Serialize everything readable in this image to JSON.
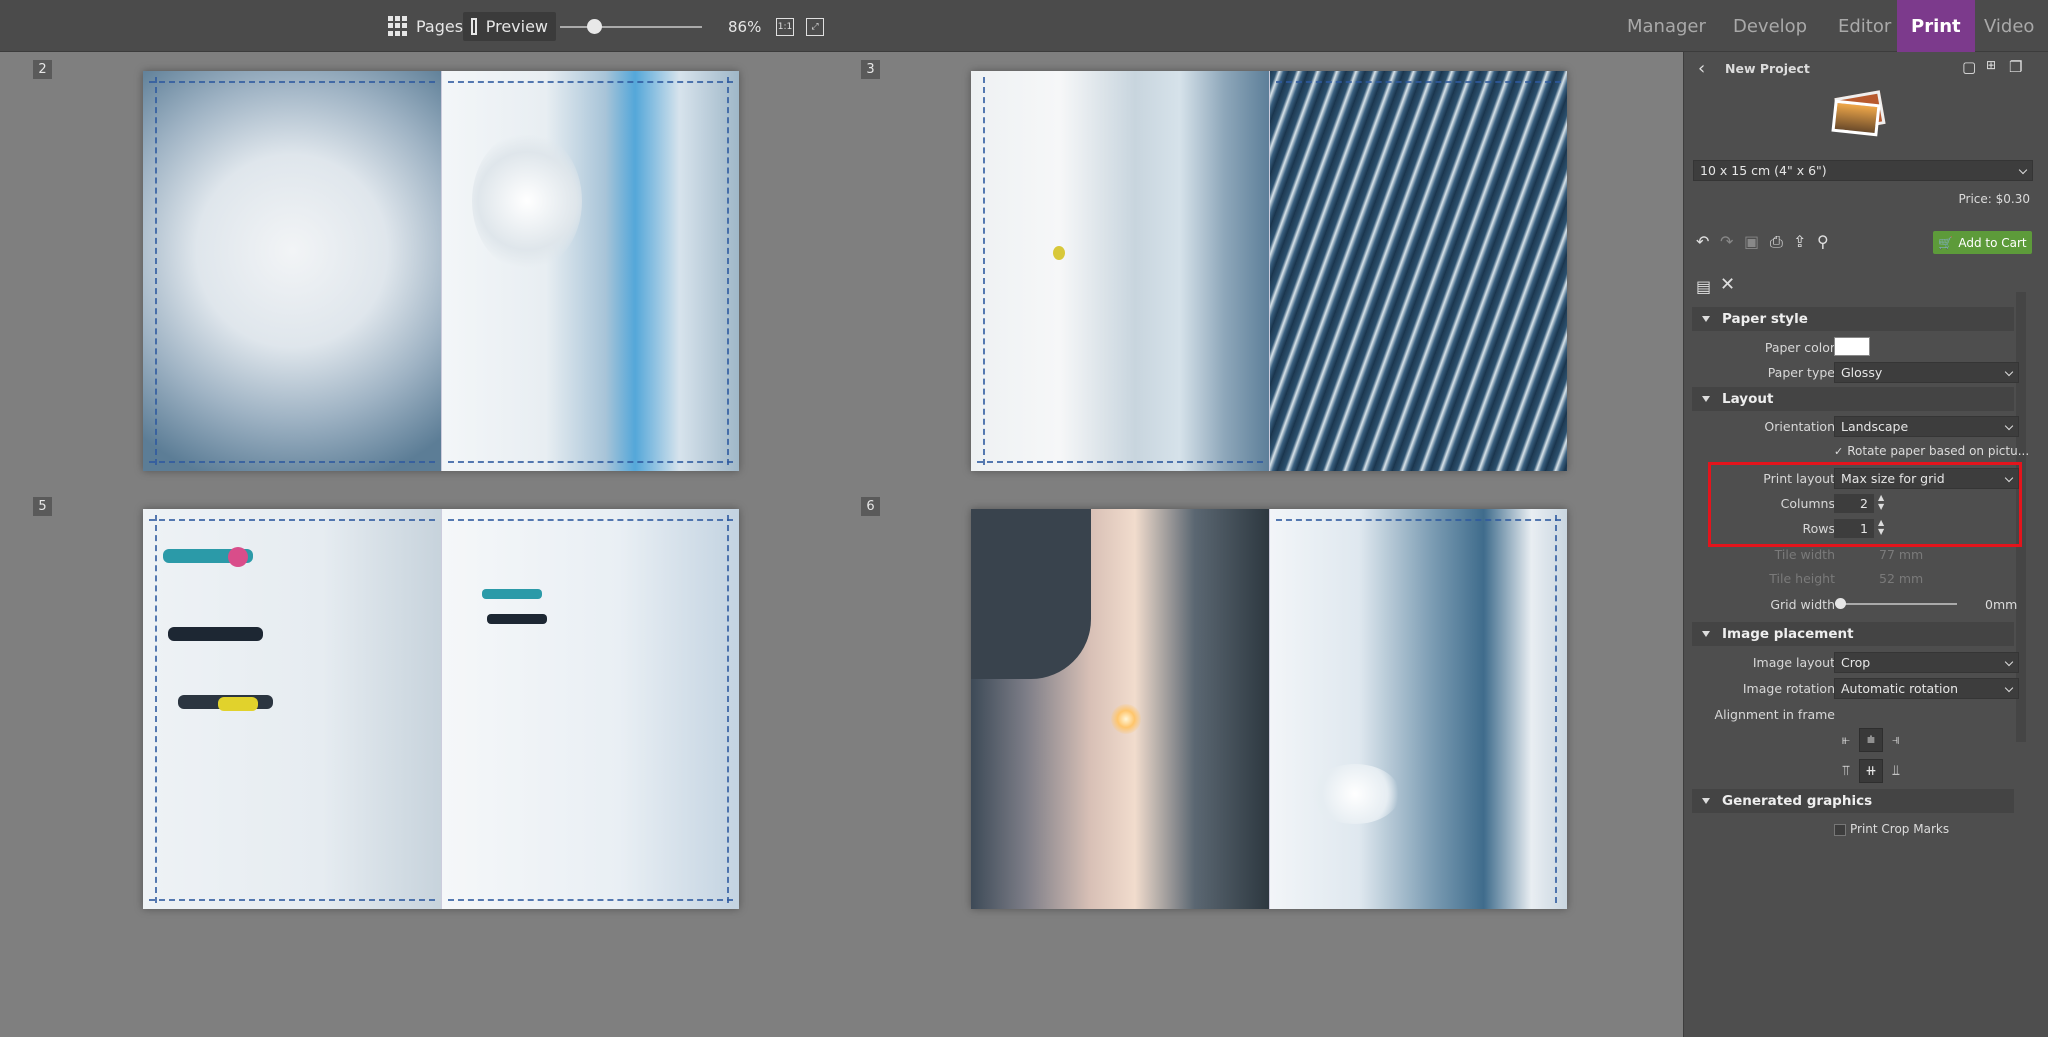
{
  "toolbar": {
    "pages_label": "Pages",
    "preview_label": "Preview",
    "zoom": "86%",
    "actual_size_label": "1:1"
  },
  "nav": {
    "tabs": [
      "Manager",
      "Develop",
      "Editor",
      "Print",
      "Video"
    ],
    "active": "Print"
  },
  "canvas": {
    "page_numbers": [
      "2",
      "3",
      "5",
      "6"
    ]
  },
  "panel": {
    "project_title": "New Project",
    "paper_size": "10 x 15 cm (4\" x 6\")",
    "price": "Price: $0.30",
    "add_to_cart": "Add to Cart",
    "paper_style": {
      "heading": "Paper style",
      "paper_color_label": "Paper color",
      "paper_type_label": "Paper type",
      "paper_type": "Glossy"
    },
    "layout": {
      "heading": "Layout",
      "orientation_label": "Orientation",
      "orientation": "Landscape",
      "rotate_paper": "Rotate paper based on pictu...",
      "print_layout_label": "Print layout",
      "print_layout": "Max size for grid",
      "columns_label": "Columns",
      "columns": "2",
      "rows_label": "Rows",
      "rows": "1",
      "tile_width_label": "Tile width",
      "tile_width": "77 mm",
      "tile_height_label": "Tile height",
      "tile_height": "52 mm",
      "grid_width_label": "Grid width",
      "grid_width": "0mm"
    },
    "image_placement": {
      "heading": "Image placement",
      "image_layout_label": "Image layout",
      "image_layout": "Crop",
      "image_rotation_label": "Image rotation",
      "image_rotation": "Automatic rotation",
      "alignment_label": "Alignment in frame"
    },
    "generated_graphics": {
      "heading": "Generated graphics",
      "print_crop_marks": "Print Crop Marks"
    }
  },
  "colors": {
    "accent_print_tab": "#7c3a8c",
    "add_to_cart": "#5d9b3a",
    "highlight_box": "#e4141c"
  }
}
